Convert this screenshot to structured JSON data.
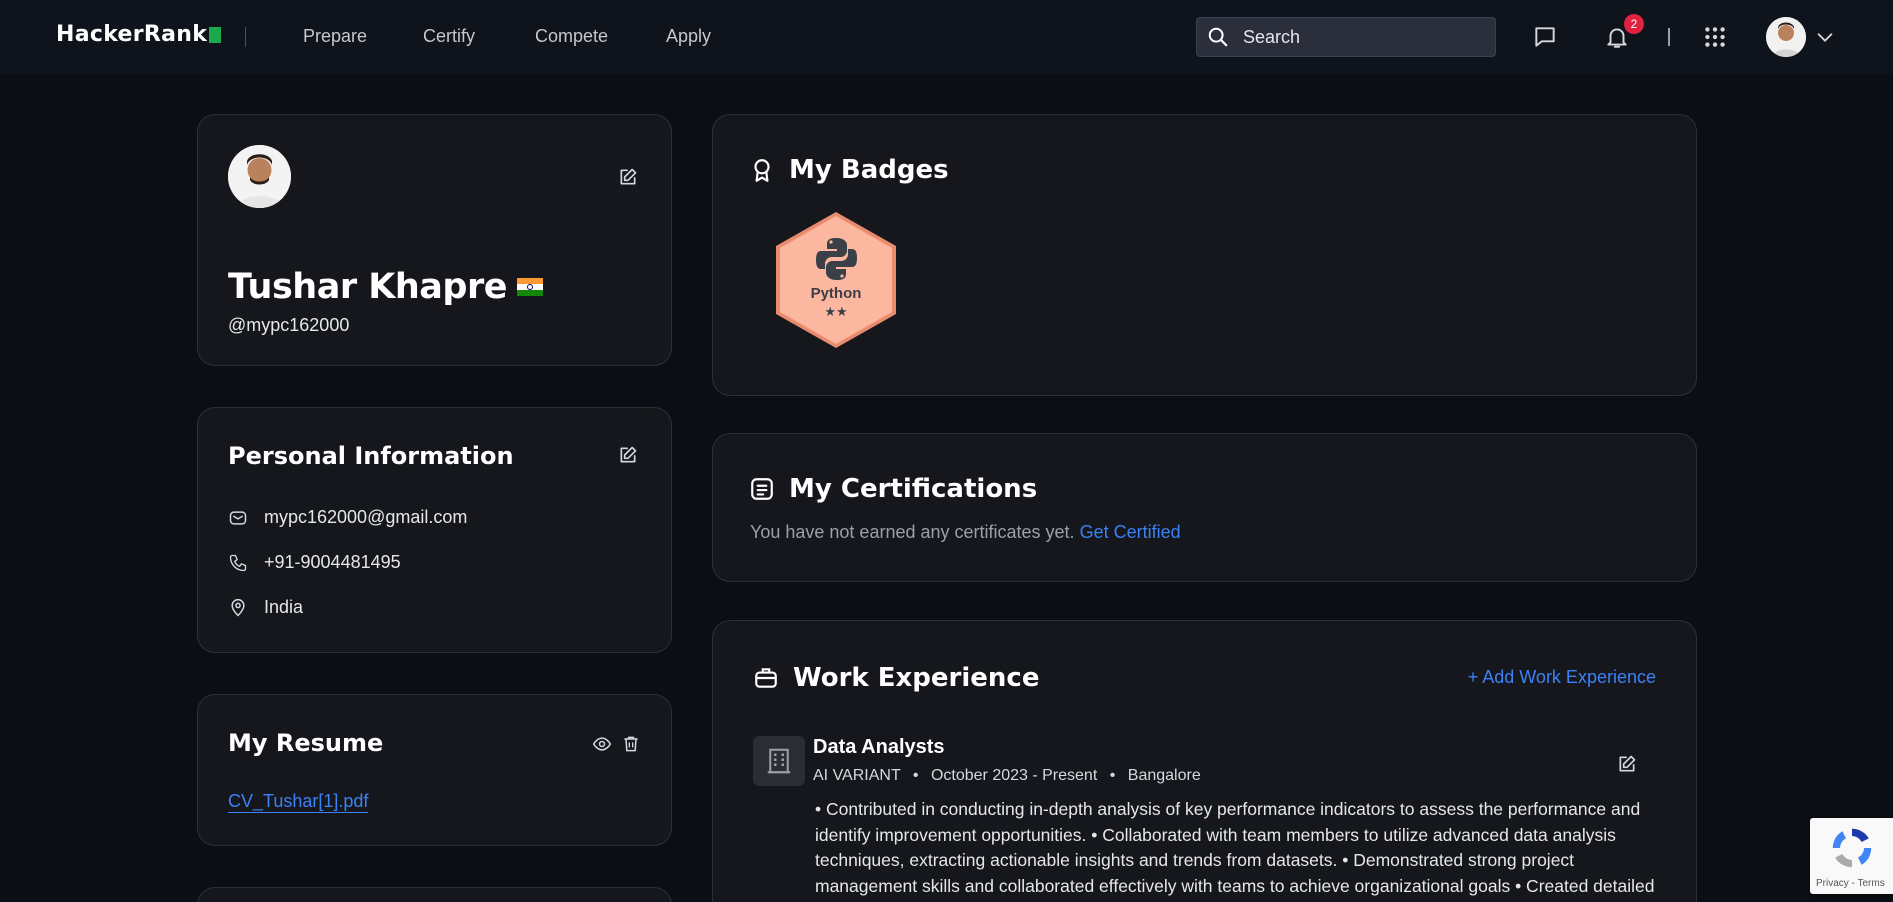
{
  "nav": {
    "logo": "HackerRank",
    "links": [
      "Prepare",
      "Certify",
      "Compete",
      "Apply"
    ],
    "search_placeholder": "Search",
    "notification_count": "2"
  },
  "profile": {
    "name": "Tushar Khapre",
    "handle": "@mypc162000",
    "country_flag": "india-flag"
  },
  "personal_info": {
    "title": "Personal Information",
    "email": "mypc162000@gmail.com",
    "phone": "+91-9004481495",
    "location": "India"
  },
  "resume": {
    "title": "My Resume",
    "file": "CV_Tushar[1].pdf"
  },
  "badges": {
    "title": "My Badges",
    "items": [
      {
        "name": "Python",
        "stars": "★★",
        "color": "#f9a98a"
      }
    ]
  },
  "certifications": {
    "title": "My Certifications",
    "empty_text": "You have not earned any certificates yet.",
    "cta": "Get Certified"
  },
  "work": {
    "title": "Work Experience",
    "add_label": "+ Add Work Experience",
    "jobs": [
      {
        "title": "Data Analysts",
        "company": "AI VARIANT",
        "period": "October 2023 - Present",
        "location": "Bangalore",
        "description": "• Contributed in conducting in-depth analysis of key performance indicators to assess the performance and identify improvement opportunities. • Collaborated with team members to utilize advanced data analysis techniques, extracting actionable insights and trends from datasets. • Demonstrated strong project management skills and collaborated effectively with teams to achieve organizational goals • Created detailed"
      }
    ]
  },
  "recaptcha": {
    "links": "Privacy - Terms"
  },
  "colors": {
    "accent": "#3b82f6",
    "brand_green": "#1ba94c",
    "badge": "#f9a98a",
    "notification": "#e0223f"
  }
}
